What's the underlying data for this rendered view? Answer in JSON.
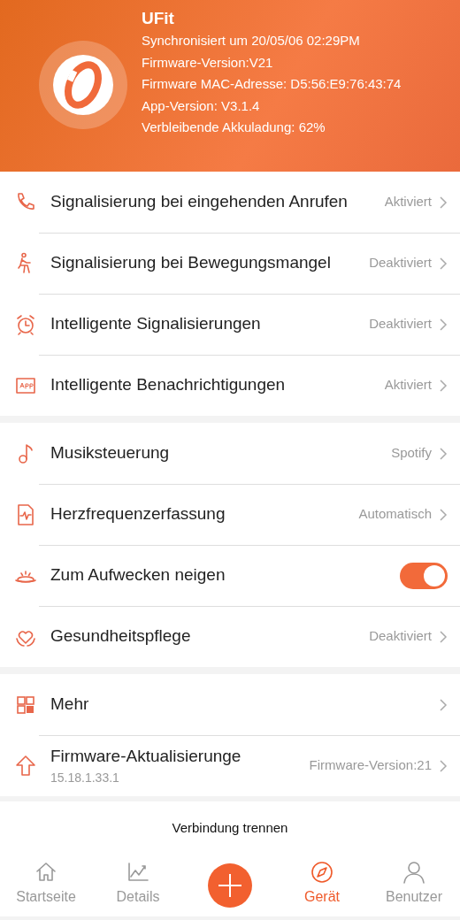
{
  "device": {
    "name": "UFit",
    "info": [
      "Synchronisiert um 20/05/06 02:29PM",
      "Firmware-Version:V21",
      "Firmware MAC-Adresse: D5:56:E9:76:43:74",
      "App-Version: V3.1.4",
      "Verbleibende Akkuladung: 62%"
    ]
  },
  "sections": [
    {
      "rows": [
        {
          "kind": "value",
          "label": "Signalisierung bei eingehenden Anrufen",
          "value": "Aktiviert"
        },
        {
          "kind": "value",
          "label": "Signalisierung bei Bewegungsmangel",
          "value": "Deaktiviert"
        },
        {
          "kind": "value",
          "label": "Intelligente Signalisierungen",
          "value": "Deaktiviert"
        },
        {
          "kind": "value",
          "label": "Intelligente Benachrichtigungen",
          "value": "Aktiviert"
        }
      ]
    },
    {
      "rows": [
        {
          "kind": "value",
          "label": "Musiksteuerung",
          "value": "Spotify"
        },
        {
          "kind": "value",
          "label": "Herzfrequenzerfassung",
          "value": "Automatisch"
        },
        {
          "kind": "toggle",
          "label": "Zum Aufwecken neigen",
          "on": true
        },
        {
          "kind": "value",
          "label": "Gesundheitspflege",
          "value": "Deaktiviert"
        }
      ]
    },
    {
      "rows": [
        {
          "kind": "value",
          "label": "Mehr"
        },
        {
          "kind": "value",
          "label": "Firmware-Aktualisierunge",
          "sublabel": "15.18.1.33.1",
          "value": "Firmware-Version:21"
        }
      ]
    }
  ],
  "disconnect": "Verbindung trennen",
  "tabs": [
    {
      "kind": "tab",
      "label": "Startseite",
      "selected": false
    },
    {
      "kind": "tab",
      "label": "Details",
      "selected": false
    },
    {
      "kind": "add"
    },
    {
      "kind": "tab",
      "label": "Gerät",
      "selected": true
    },
    {
      "kind": "tab",
      "label": "Benutzer",
      "selected": false
    }
  ]
}
